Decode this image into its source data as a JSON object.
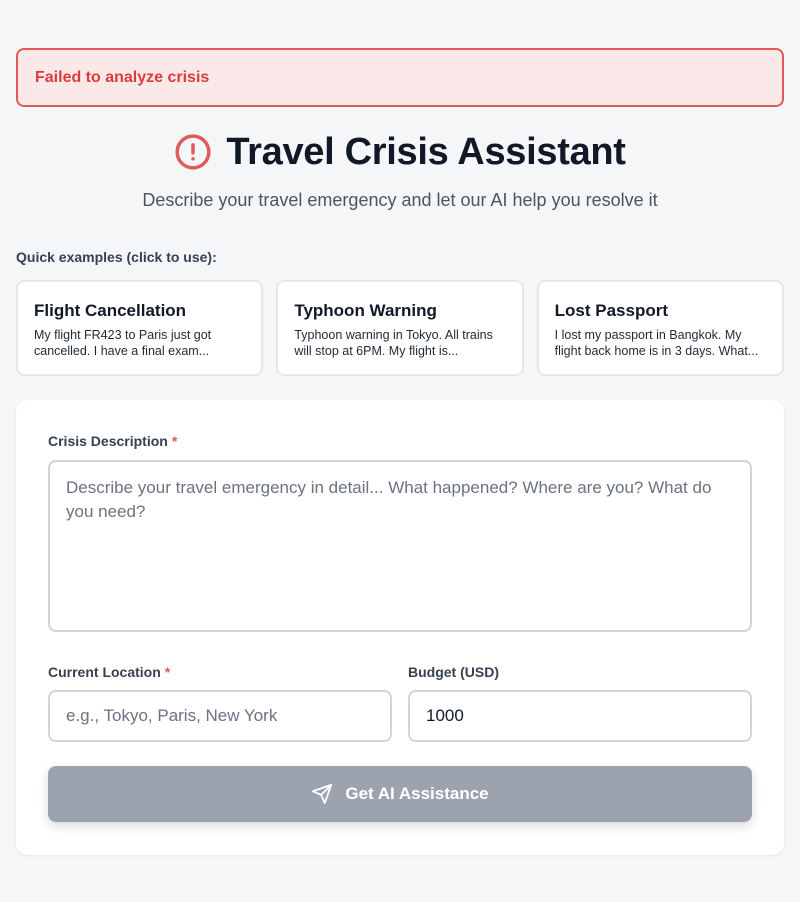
{
  "error": {
    "message": "Failed to analyze crisis",
    "color": "#dc3c3c"
  },
  "header": {
    "title": "Travel Crisis Assistant",
    "icon": "alert-circle-icon",
    "subtitle": "Describe your travel emergency and let our AI help you resolve it"
  },
  "examples": {
    "label": "Quick examples (click to use):",
    "items": [
      {
        "title": "Flight Cancellation",
        "description": "My flight FR423 to Paris just got cancelled. I have a final exam..."
      },
      {
        "title": "Typhoon Warning",
        "description": "Typhoon warning in Tokyo. All trains will stop at 6PM. My flight is..."
      },
      {
        "title": "Lost Passport",
        "description": "I lost my passport in Bangkok. My flight back home is in 3 days. What..."
      }
    ]
  },
  "form": {
    "crisis": {
      "label": "Crisis Description",
      "required_mark": "*",
      "placeholder": "Describe your travel emergency in detail... What happened? Where are you? What do you need?",
      "value": ""
    },
    "location": {
      "label": "Current Location",
      "required_mark": "*",
      "placeholder": "e.g., Tokyo, Paris, New York",
      "value": ""
    },
    "budget": {
      "label": "Budget (USD)",
      "value": "1000"
    },
    "submit": {
      "label": "Get AI Assistance",
      "icon": "send-icon",
      "color": "#9ca3af"
    }
  },
  "colors": {
    "accent_red": "#e05a5a",
    "background": "#f5f6f8"
  }
}
